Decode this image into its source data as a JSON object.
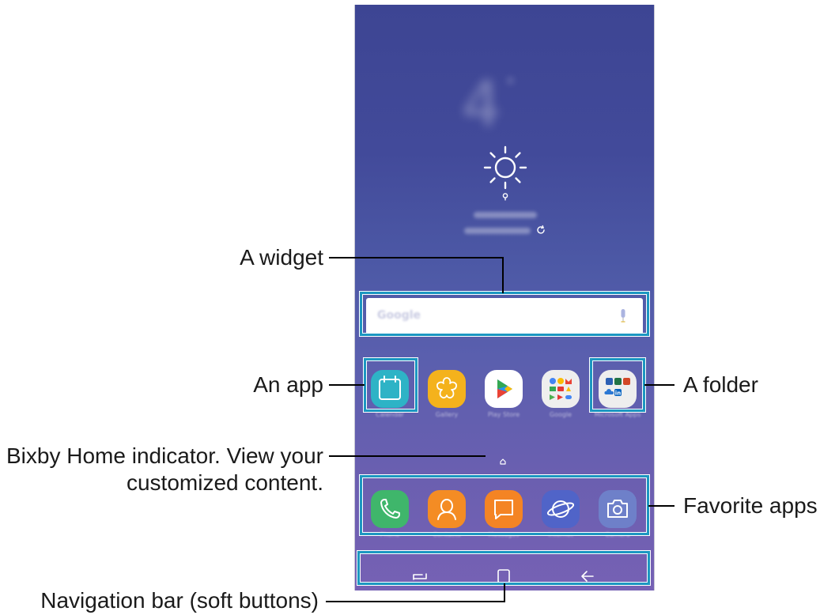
{
  "callouts": {
    "widget": "A widget",
    "app": "An app",
    "folder": "A folder",
    "bixby_line1": "Bixby Home indicator. View your",
    "bixby_line2": "customized content.",
    "favorite_apps": "Favorite apps",
    "navigation_bar": "Navigation bar (soft buttons)"
  },
  "colors": {
    "callout_box": "#1c97c1",
    "screen_top": "#3d4593",
    "screen_bottom": "#7661b4"
  },
  "apps_row": [
    {
      "name": "calendar-icon",
      "color": "#2eb3c6"
    },
    {
      "name": "gallery-icon",
      "color": "#f4b21c"
    },
    {
      "name": "play-store-icon",
      "color": "#ffffff"
    },
    {
      "name": "google-folder-icon",
      "color": "#eeeeee"
    },
    {
      "name": "microsoft-folder-icon",
      "color": "#eeeeee"
    }
  ],
  "favorites": [
    {
      "name": "phone-icon",
      "color": "#3fb66b"
    },
    {
      "name": "contacts-icon",
      "color": "#f48c24"
    },
    {
      "name": "messages-icon",
      "color": "#f48424"
    },
    {
      "name": "internet-icon",
      "color": "#5064c8"
    },
    {
      "name": "camera-icon",
      "color": "#6e80c9"
    }
  ],
  "nav_buttons": [
    {
      "name": "recents-icon"
    },
    {
      "name": "home-icon"
    },
    {
      "name": "back-icon"
    }
  ]
}
